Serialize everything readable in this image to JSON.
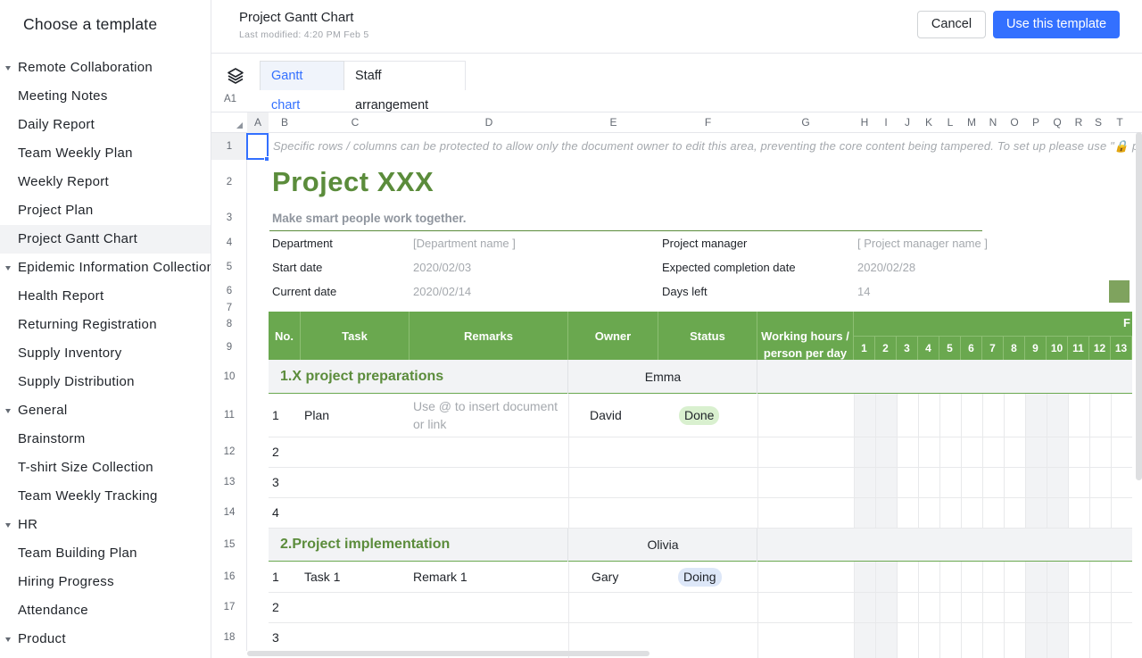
{
  "sidebar": {
    "title": "Choose a template",
    "rows": [
      {
        "label": "Remote Collaboration",
        "group": true
      },
      {
        "label": "Meeting Notes"
      },
      {
        "label": "Daily Report"
      },
      {
        "label": "Team Weekly Plan"
      },
      {
        "label": "Weekly Report"
      },
      {
        "label": "Project Plan"
      },
      {
        "label": "Project Gantt Chart",
        "active": true
      },
      {
        "label": "Epidemic Information Collection",
        "group": true
      },
      {
        "label": "Health Report"
      },
      {
        "label": "Returning Registration"
      },
      {
        "label": "Supply Inventory"
      },
      {
        "label": "Supply Distribution"
      },
      {
        "label": "General",
        "group": true
      },
      {
        "label": "Brainstorm"
      },
      {
        "label": "T-shirt Size Collection"
      },
      {
        "label": "Team Weekly Tracking"
      },
      {
        "label": "HR",
        "group": true
      },
      {
        "label": "Team Building Plan"
      },
      {
        "label": "Hiring Progress"
      },
      {
        "label": "Attendance"
      },
      {
        "label": "Product",
        "group": true
      }
    ]
  },
  "header": {
    "title": "Project Gantt Chart",
    "last_modified": "Last modified: 4:20 PM Feb 5",
    "cancel_label": "Cancel",
    "use_label": "Use this template"
  },
  "tabs": {
    "gantt": "Gantt chart",
    "staff": "Staff arrangement",
    "cell_ref": "A1"
  },
  "columns": [
    "A",
    "B",
    "C",
    "D",
    "E",
    "F",
    "G",
    "H",
    "I",
    "J",
    "K",
    "L",
    "M",
    "N",
    "O",
    "P",
    "Q",
    "R",
    "S",
    "T"
  ],
  "row_numbers": [
    "1",
    "2",
    "3",
    "4",
    "5",
    "6",
    "7",
    "8",
    "9",
    "10",
    "11",
    "12",
    "13",
    "14",
    "15",
    "16",
    "17",
    "18"
  ],
  "sheet": {
    "note": "Specific rows / columns can be protected to allow only the document owner to edit this area, preventing the core content being tampered. To set up please use \"🔒 prote",
    "project_title": "Project XXX",
    "slogan": "Make smart people work together.",
    "department_label": "Department",
    "department_value": "[Department name ]",
    "manager_label": "Project manager",
    "manager_value": "[ Project manager name ]",
    "start_label": "Start date",
    "start_value": "2020/02/03",
    "completion_label": "Expected completion date",
    "completion_value": "2020/02/28",
    "current_label": "Current date",
    "current_value": "2020/02/14",
    "days_left_label": "Days left",
    "days_left_value": "14",
    "table_headers": {
      "no": "No.",
      "task": "Task",
      "remarks": "Remarks",
      "owner": "Owner",
      "status": "Status",
      "hours": "Working hours / person per day",
      "month_letter": "F"
    },
    "days": [
      "1",
      "2",
      "3",
      "4",
      "5",
      "6",
      "7",
      "8",
      "9",
      "10",
      "11",
      "12",
      "13"
    ],
    "section1": {
      "title": "1.X project preparations",
      "owner": "Emma",
      "rows": [
        {
          "no": "1",
          "task": "Plan",
          "remarks": "Use @ to insert document or link",
          "owner": "David",
          "status": "Done"
        },
        {
          "no": "2"
        },
        {
          "no": "3"
        },
        {
          "no": "4"
        }
      ]
    },
    "section2": {
      "title": "2.Project implementation",
      "owner": "Olivia",
      "rows": [
        {
          "no": "1",
          "task": "Task 1",
          "remarks": "Remark 1",
          "owner": "Gary",
          "status": "Doing"
        },
        {
          "no": "2"
        },
        {
          "no": "3"
        }
      ]
    }
  },
  "colors": {
    "accent": "#3370ff",
    "green_dark": "#5b8c3b",
    "green_header": "#6aa84f",
    "done_tag": "#d9f0cf",
    "doing_tag": "#dde7f8"
  }
}
